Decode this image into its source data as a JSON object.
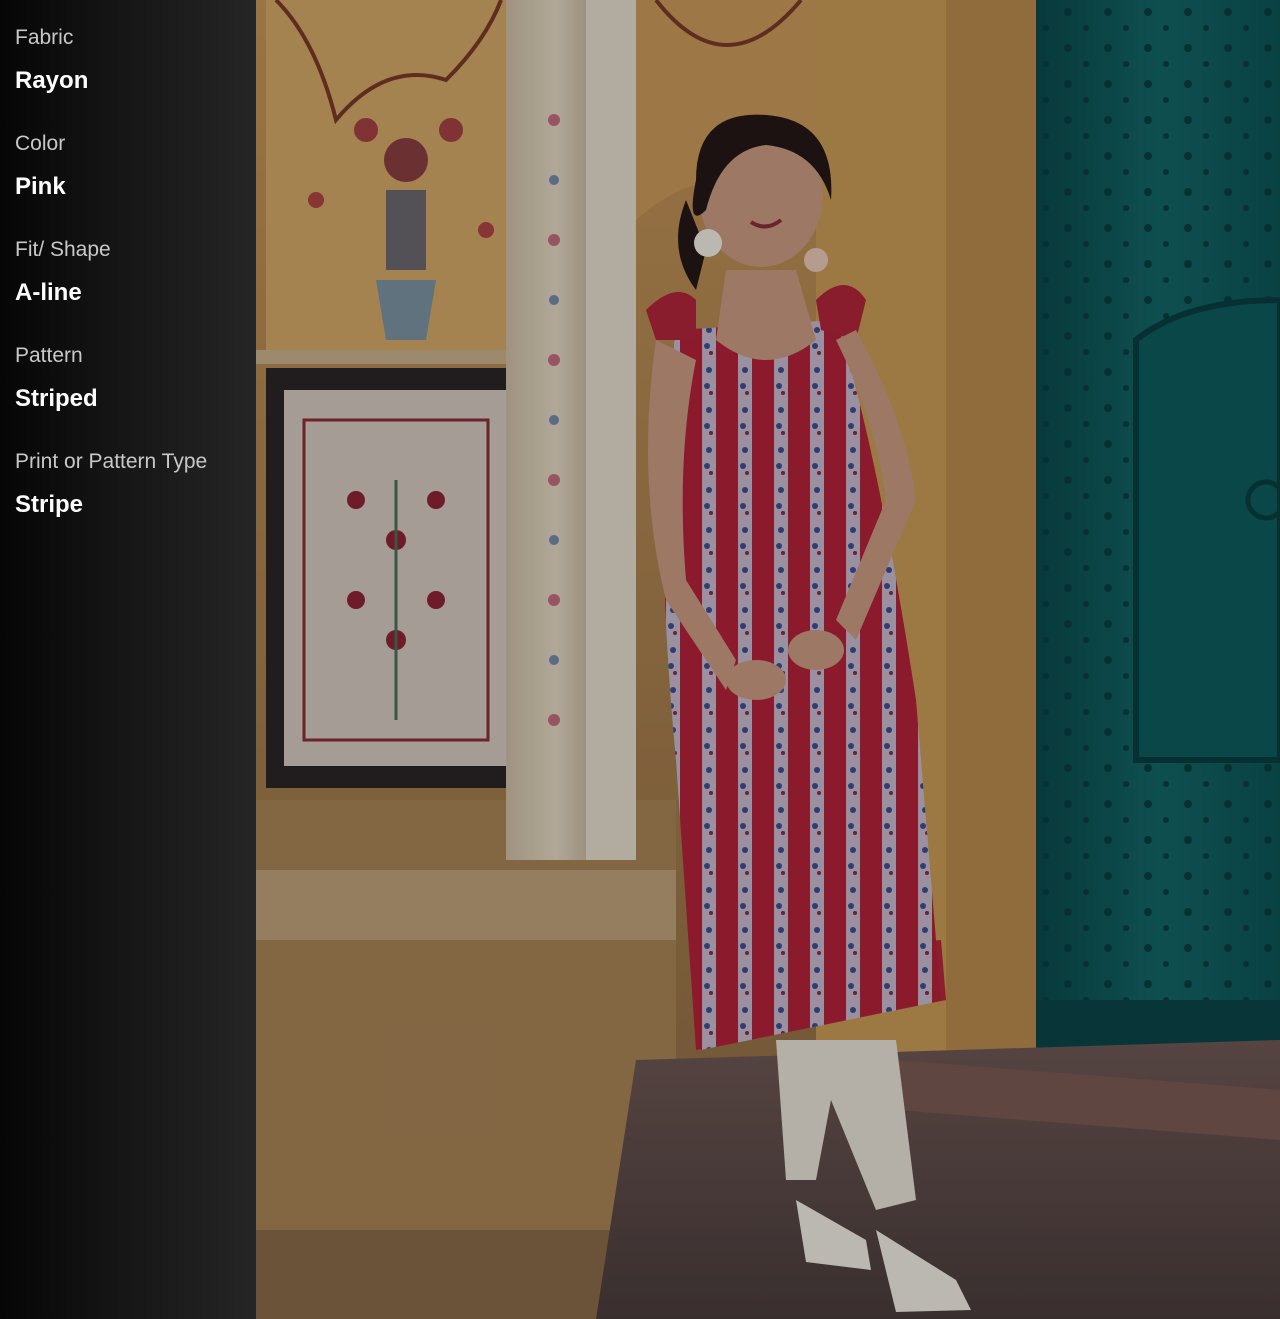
{
  "attributes": [
    {
      "label": "Fabric",
      "value": "Rayon"
    },
    {
      "label": "Color",
      "value": "Pink"
    },
    {
      "label": "Fit/ Shape",
      "value": "A-line"
    },
    {
      "label": "Pattern",
      "value": "Striped"
    },
    {
      "label": "Print or Pattern Type",
      "value": "Stripe"
    }
  ],
  "photo": {
    "palette": {
      "wall": "#b98a4e",
      "pillar": "#d9cdb8",
      "door": "#0f5a5c",
      "dress": "#b0243a",
      "floor": "#5a4a48"
    }
  }
}
